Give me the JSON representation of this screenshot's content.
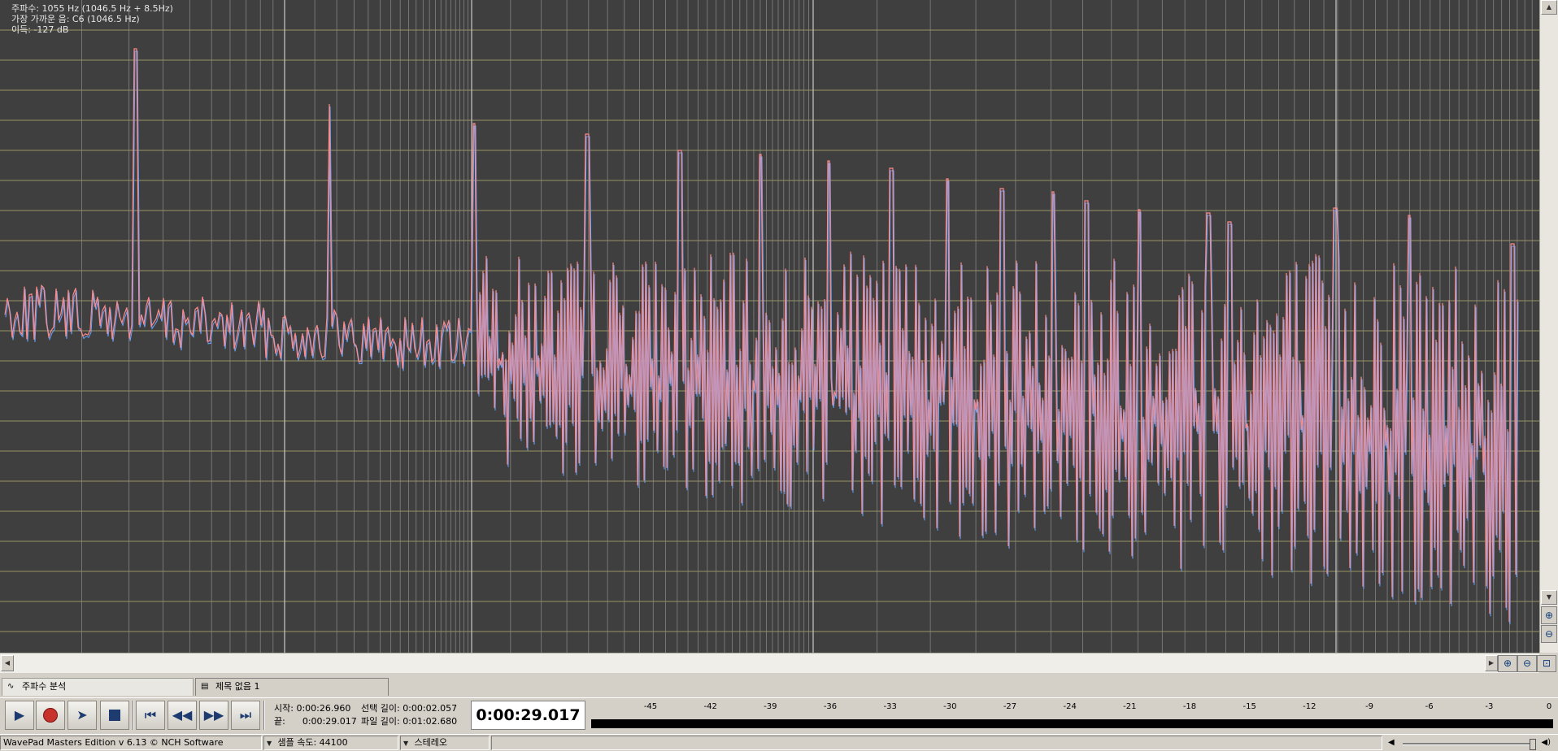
{
  "readout": {
    "frequency": "주파수: 1055 Hz (1046.5 Hz + 8.5Hz)",
    "nearest_note": "가장 가까운 음: C6 (1046.5 Hz)",
    "gain": "이득: -127 dB"
  },
  "colors": {
    "plot_background": "#3f3f3f",
    "grid_major": "#c8c8c8",
    "grid_minor": "#8d8d8d",
    "grid_horizontal": "#b7b070",
    "trace_primary": "#ff8a8a",
    "trace_secondary": "#6aa6ff"
  },
  "tabs": [
    {
      "label": "주파수 분석",
      "icon": "spectrum-icon"
    },
    {
      "label": "제목 없음 1",
      "icon": "waveform-icon"
    }
  ],
  "transport": {
    "start_label": "시작:",
    "start_value": "0:00:26.960",
    "end_label": "끝:",
    "end_value": "0:00:29.017",
    "selection_length_label": "선택 길이:",
    "selection_length_value": "0:00:02.057",
    "file_length_label": "파일 길이:",
    "file_length_value": "0:01:02.680",
    "current_time": "0:00:29.017",
    "buttons": [
      "play-icon",
      "record-icon",
      "scrub-icon",
      "stop-icon",
      "skip-start-icon",
      "rewind-icon",
      "fast-forward-icon",
      "skip-end-icon"
    ]
  },
  "meter": {
    "labels": [
      "-45",
      "-42",
      "-39",
      "-36",
      "-33",
      "-30",
      "-27",
      "-24",
      "-21",
      "-18",
      "-15",
      "-12",
      "-9",
      "-6",
      "-3",
      "0"
    ]
  },
  "status": {
    "app_title": "WavePad Masters Edition v 6.13 © NCH Software",
    "sample_rate": "샘플 속도: 44100",
    "channels": "스테레오"
  }
}
